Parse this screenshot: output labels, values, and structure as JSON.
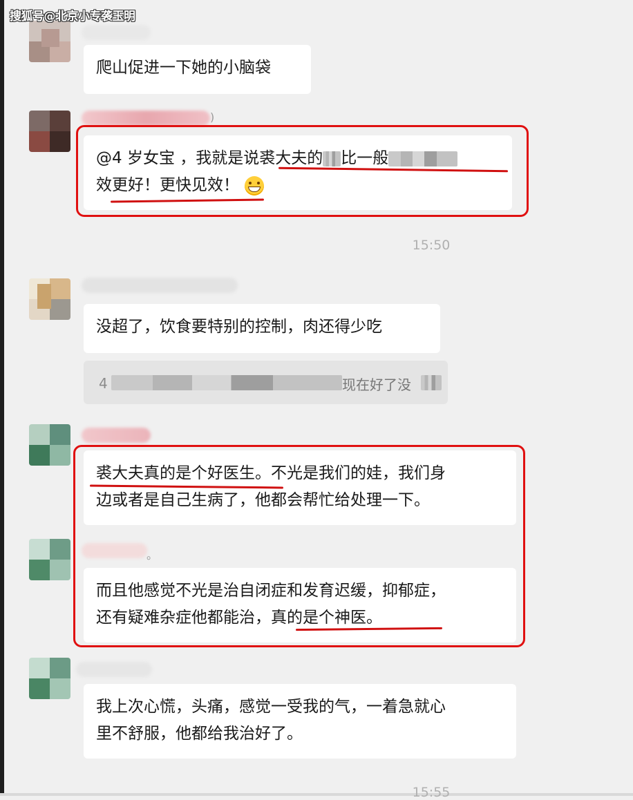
{
  "watermark": "搜狐号@北京小专袭玉明",
  "messages": [
    {
      "lines": [
        "爬山促进一下她的小脑袋"
      ]
    },
    {
      "line1_prefix": "@4 岁女宝 ，我就是说裘大夫的",
      "line1_mid": "比一般",
      "line2": "效更好！更快见效！",
      "emoji": "grinning-face-emoji"
    },
    {
      "lines": [
        "没超了，饮食要特别的控制，肉还得少吃"
      ]
    },
    {
      "quote_start": "4",
      "quote_end": "现在好了没"
    },
    {
      "lines": [
        "裘大夫真的是个好医生。不光是我们的娃，我们身",
        "边或者是自己生病了，他都会帮忙给处理一下。"
      ]
    },
    {
      "lines": [
        "而且他感觉不光是治自闭症和发育迟缓，抑郁症，",
        "还有疑难杂症他都能治，真的是个神医。"
      ]
    },
    {
      "lines": [
        "我上次心慌，头痛，感觉一受我的气，一着急就心",
        "里不舒服，他都给我治好了。"
      ]
    }
  ],
  "timestamps": [
    "15:50",
    "15:55"
  ],
  "name_suffixes": [
    ")",
    "。"
  ],
  "colors": {
    "background": "#f0f0f0",
    "bubble": "#ffffff",
    "highlight_red": "#e01010",
    "timestamp": "#b0b0b0"
  }
}
